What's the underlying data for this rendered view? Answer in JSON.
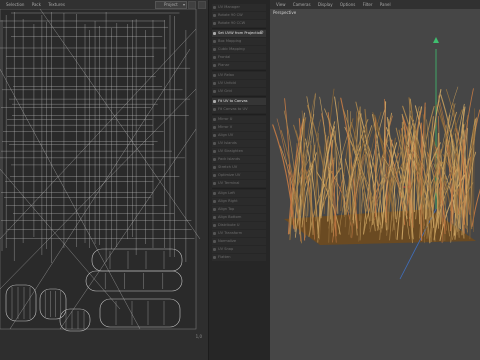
{
  "uv_menu": [
    "Selection",
    "Pack",
    "Textures"
  ],
  "uv_mode": "Project",
  "tools": {
    "group1": [
      "UV Manager",
      "Rotate 90 CW",
      "Rotate 90 CCW"
    ],
    "set_uvw": "Set UVW from Projection",
    "group2": [
      "Box Mapping",
      "Cubic Mapping",
      "Frontal",
      "Planar"
    ],
    "group3": [
      "UV Relax",
      "UV Unfold",
      "UV Grid"
    ],
    "fit_uv": "Fit UV to Canvas",
    "fit_sub": "Fit Canvas to UV",
    "group4": [
      "Mirror U",
      "Mirror V",
      "Align UV",
      "UV Islands",
      "UV Straighten",
      "Pack Islands",
      "Stretch UV",
      "Optimize UV",
      "UV Terminal"
    ],
    "group5": [
      "Align Left",
      "Align Right",
      "Align Top",
      "Align Bottom",
      "Distribute U",
      "UV Transform",
      "Normalize",
      "UV Snap",
      "Flatten"
    ]
  },
  "uv_frame_label": "1,0",
  "viewport_menu": [
    "View",
    "Cameras",
    "Display",
    "Options",
    "Filter",
    "Panel"
  ],
  "viewport_label": "Perspective",
  "colors": {
    "accent_green": "#3fbf6f",
    "accent_blue": "#3f6fbf",
    "accent_red": "#c84040",
    "grass_base": "#6a4a22"
  }
}
